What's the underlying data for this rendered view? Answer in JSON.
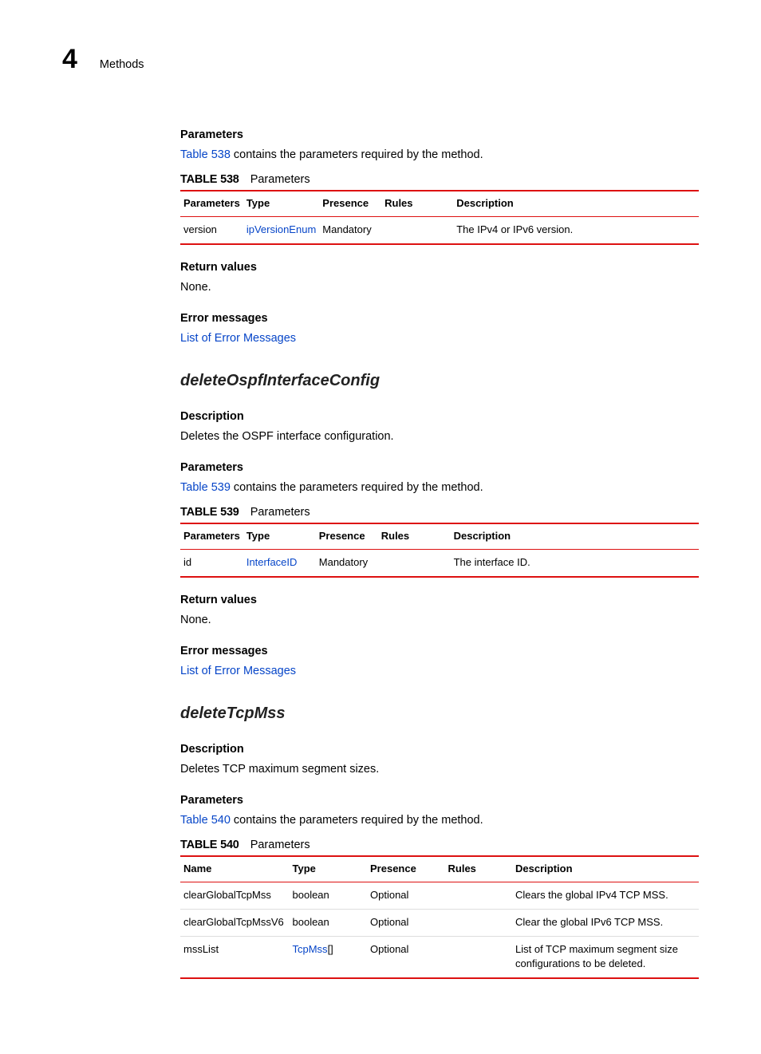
{
  "header": {
    "chapter_number": "4",
    "chapter_title": "Methods"
  },
  "sections": {
    "s1": {
      "parameters_heading": "Parameters",
      "param_intro_link": "Table 538",
      "param_intro_rest": " contains the parameters required by the method.",
      "table_label": "TABLE 538",
      "table_title": "Parameters",
      "cols": {
        "c1": "Parameters",
        "c2": "Type",
        "c3": "Presence",
        "c4": "Rules",
        "c5": "Description"
      },
      "rows": [
        {
          "c1": "version",
          "c2": "ipVersionEnum",
          "c2_link": true,
          "c3": "Mandatory",
          "c4": "",
          "c5": "The IPv4 or IPv6 version."
        }
      ],
      "return_heading": "Return values",
      "return_text": "None.",
      "error_heading": "Error messages",
      "error_link": "List of Error Messages"
    },
    "s2": {
      "method_title": "deleteOspfInterfaceConfig",
      "desc_heading": "Description",
      "desc_text": "Deletes the OSPF interface configuration.",
      "parameters_heading": "Parameters",
      "param_intro_link": "Table 539",
      "param_intro_rest": " contains the parameters required by the method.",
      "table_label": "TABLE 539",
      "table_title": "Parameters",
      "cols": {
        "c1": "Parameters",
        "c2": "Type",
        "c3": "Presence",
        "c4": "Rules",
        "c5": "Description"
      },
      "rows": [
        {
          "c1": "id",
          "c2": "InterfaceID",
          "c2_link": true,
          "c3": "Mandatory",
          "c4": "",
          "c5": "The interface ID."
        }
      ],
      "return_heading": "Return values",
      "return_text": "None.",
      "error_heading": "Error messages",
      "error_link": "List of Error Messages"
    },
    "s3": {
      "method_title": "deleteTcpMss",
      "desc_heading": "Description",
      "desc_text": "Deletes TCP maximum segment sizes.",
      "parameters_heading": "Parameters",
      "param_intro_link": "Table 540",
      "param_intro_rest": " contains the parameters required by the method.",
      "table_label": "TABLE 540",
      "table_title": "Parameters",
      "cols": {
        "c1": "Name",
        "c2": "Type",
        "c3": "Presence",
        "c4": "Rules",
        "c5": "Description"
      },
      "rows": [
        {
          "c1": "clearGlobalTcpMss",
          "c2": "boolean",
          "c2_link": false,
          "c3": "Optional",
          "c4": "",
          "c5": "Clears the global IPv4 TCP MSS."
        },
        {
          "c1": "clearGlobalTcpMssV6",
          "c2": "boolean",
          "c2_link": false,
          "c3": "Optional",
          "c4": "",
          "c5": "Clear the global IPv6 TCP MSS."
        },
        {
          "c1": "mssList",
          "c2": "TcpMss[]",
          "c2_link": true,
          "c2_link_text": "TcpMss",
          "c2_suffix": "[]",
          "c3": "Optional",
          "c4": "",
          "c5": "List of TCP maximum segment size configurations to be deleted."
        }
      ]
    }
  }
}
